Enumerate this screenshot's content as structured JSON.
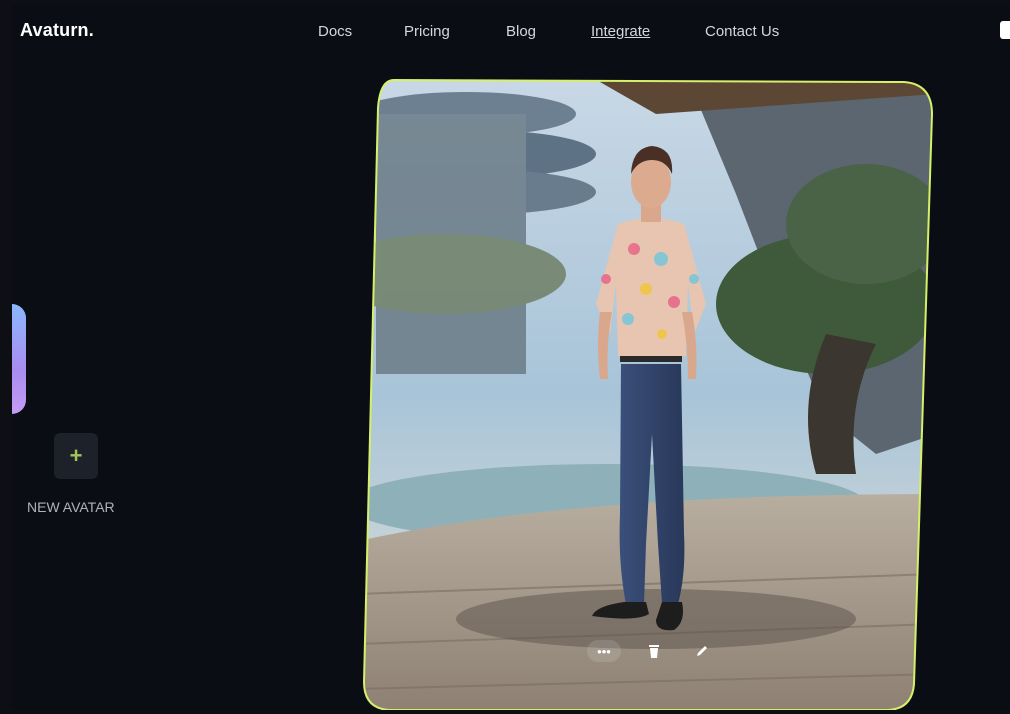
{
  "header": {
    "logo": "Avaturn.",
    "nav": [
      "Docs",
      "Pricing",
      "Blog",
      "Integrate",
      "Contact Us"
    ]
  },
  "sidebar": {
    "add_icon": "plus-icon",
    "new_avatar_label": "NEW AVATAR"
  },
  "avatar_card": {
    "border_color": "#d6f06a",
    "controls": {
      "more_icon": "more-dots-icon",
      "delete_icon": "trash-icon",
      "edit_icon": "pencil-icon"
    }
  }
}
